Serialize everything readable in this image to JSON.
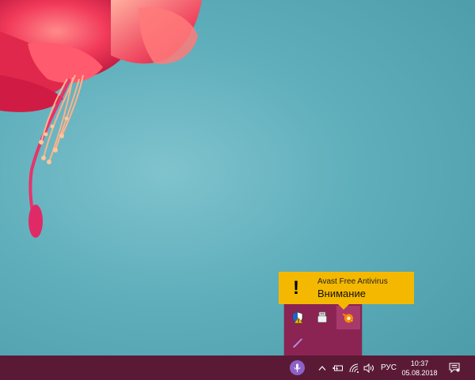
{
  "notification": {
    "title": "Avast Free Antivirus",
    "message": "Внимание"
  },
  "tray_overflow": {
    "icons": [
      "security-shield-warning-icon",
      "usb-device-icon",
      "avast-icon",
      "pen-stylus-icon"
    ]
  },
  "taskbar": {
    "language": "РУС",
    "time": "10:37",
    "date": "05.08.2018",
    "icons": [
      "microphone-icon",
      "chevron-up-icon",
      "battery-icon",
      "wifi-icon",
      "volume-icon",
      "action-center-icon"
    ]
  },
  "colors": {
    "taskbar": "#5a1a36",
    "overflow_panel": "#8b2452",
    "tooltip": "#f5b800",
    "mic_accent": "#8c61c9"
  }
}
